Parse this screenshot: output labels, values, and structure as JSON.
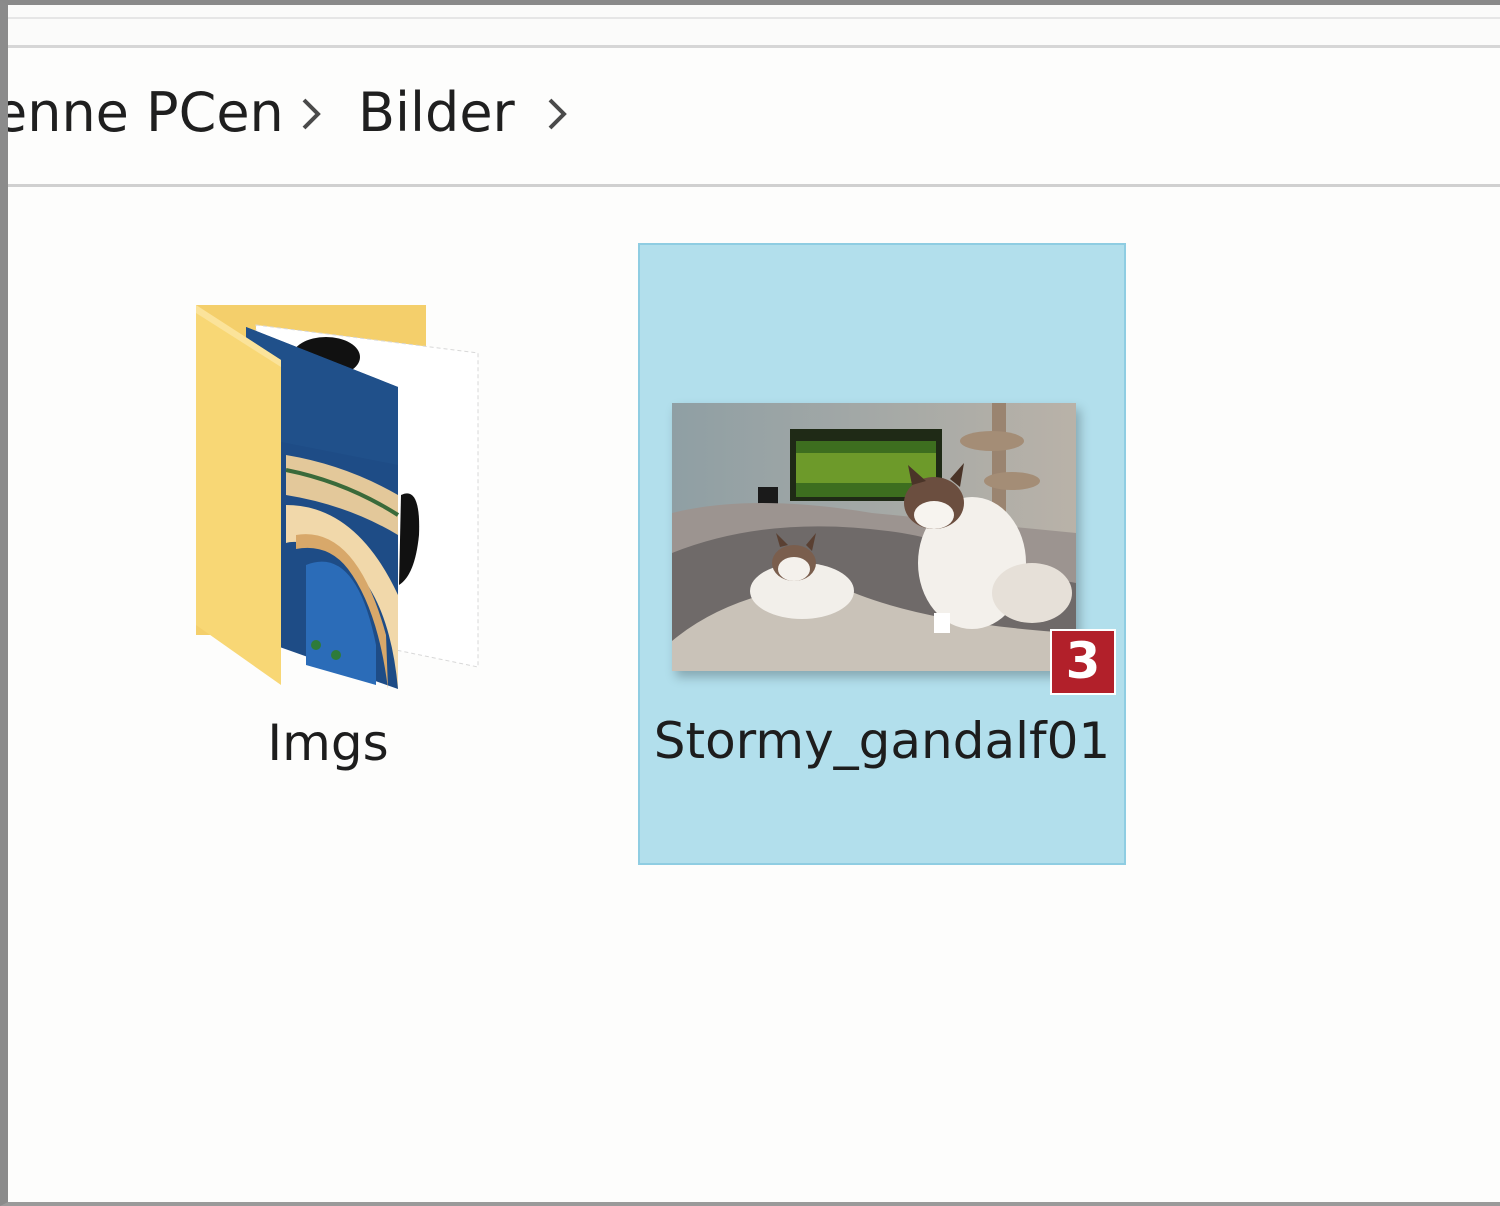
{
  "breadcrumb": {
    "items": [
      {
        "label": "enne PCen"
      },
      {
        "label": "Bilder"
      }
    ]
  },
  "files": [
    {
      "name": "Imgs",
      "type": "folder",
      "icon": "folder-with-image-icon",
      "selected": false
    },
    {
      "name": "Stormy_gandalf01",
      "type": "image",
      "icon": "image-thumbnail",
      "selected": true,
      "selection_color": "#b2dfec"
    }
  ],
  "annotation": {
    "badge_number": "3",
    "badge_color": "#b2202a"
  }
}
